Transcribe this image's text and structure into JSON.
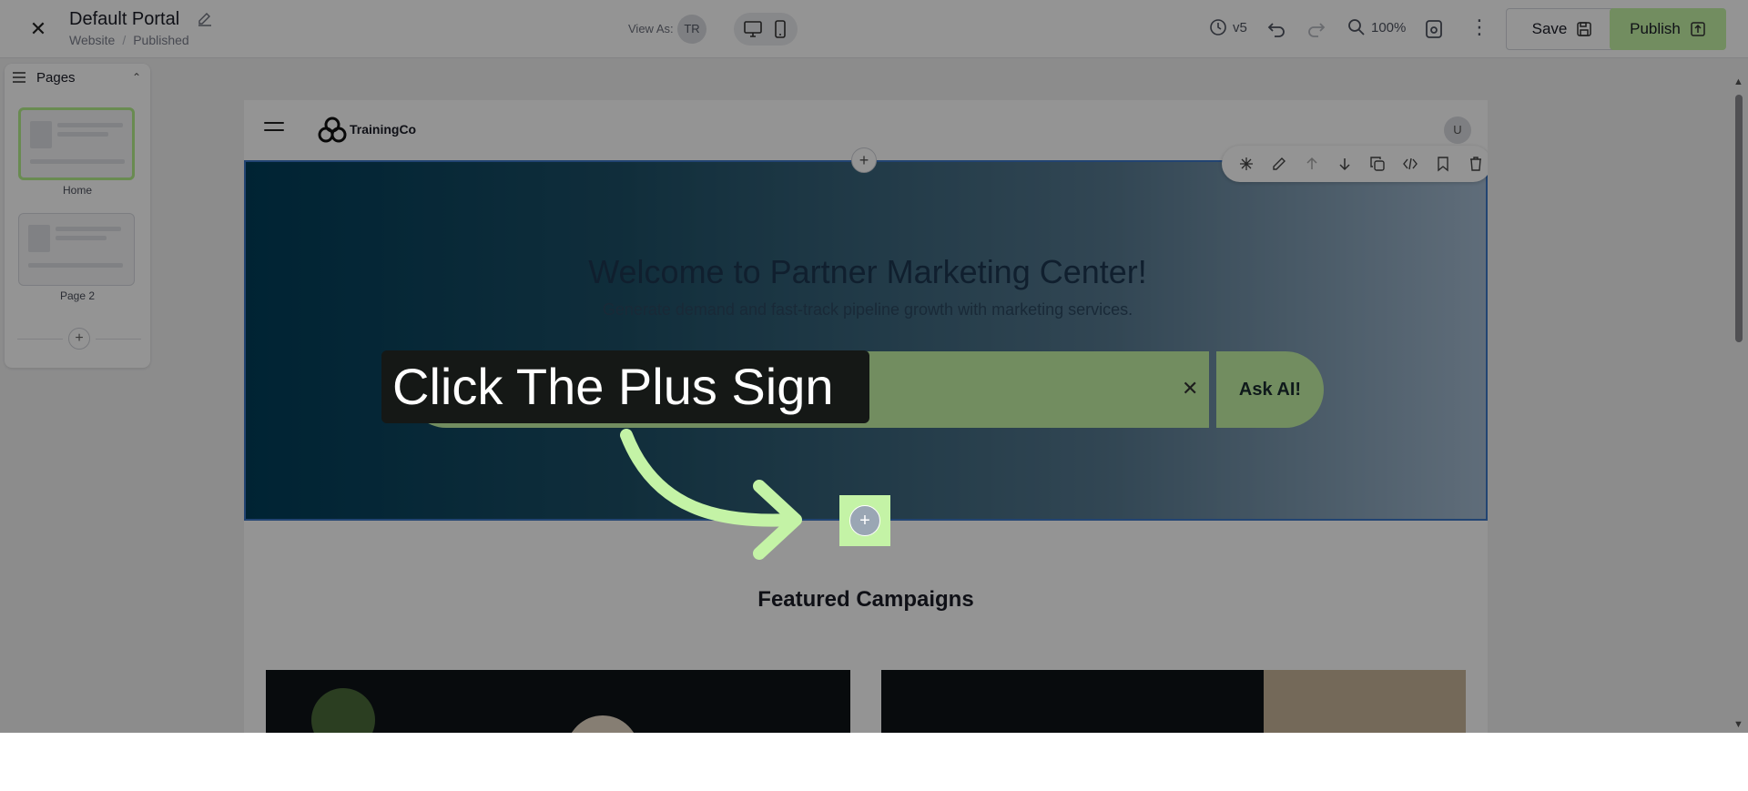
{
  "topbar": {
    "title": "Default Portal",
    "breadcrumb": [
      "Website",
      "Published"
    ],
    "view_as_label": "View As:",
    "view_as_initials": "TR",
    "version": "v5",
    "zoom": "100%",
    "save_label": "Save",
    "publish_label": "Publish"
  },
  "pages_panel": {
    "title": "Pages",
    "pages": [
      {
        "label": "Home",
        "active": true
      },
      {
        "label": "Page 2",
        "active": false
      }
    ]
  },
  "site": {
    "brand": "TrainingCo",
    "user_initial": "U",
    "hero": {
      "title": "Welcome to Partner Marketing Center!",
      "subtitle": "Generate demand and fast-track pipeline growth with marketing services.",
      "ask_button": "Ask AI!"
    },
    "featured_heading": "Featured Campaigns"
  },
  "tutorial": {
    "callout_text": "Click The Plus Sign"
  },
  "colors": {
    "accent_green": "#c4f3a6",
    "selection_blue": "#3b75c5",
    "hero_dark": "#003d59"
  }
}
